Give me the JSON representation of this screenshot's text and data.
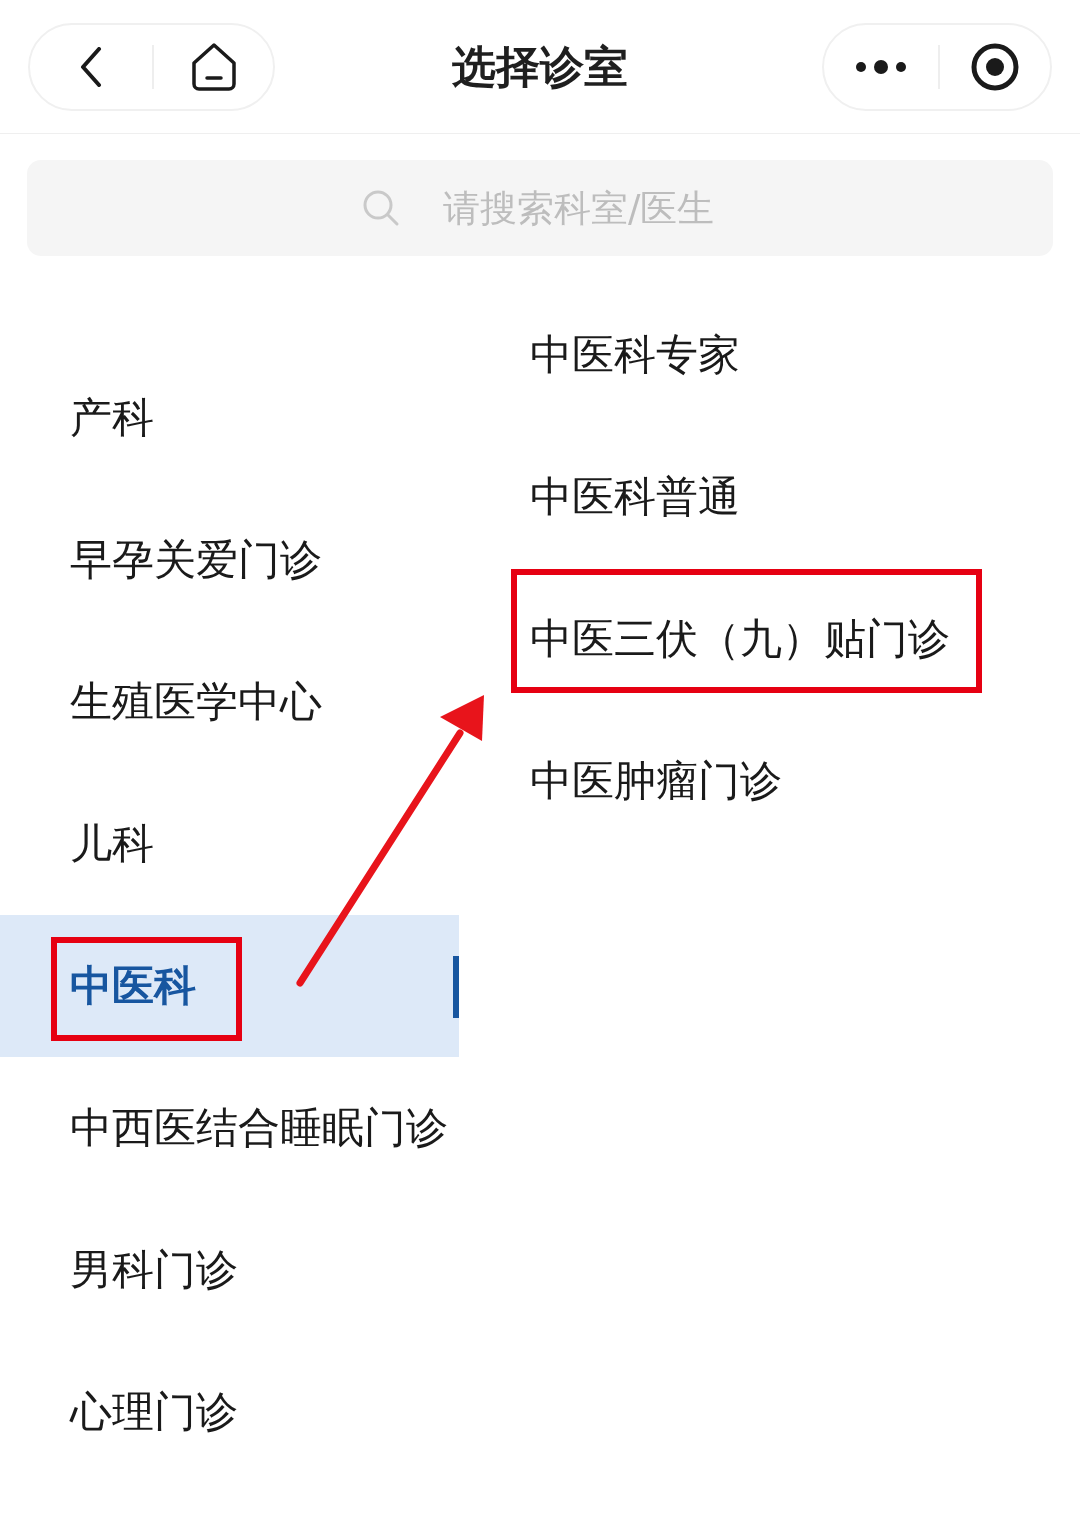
{
  "nav_bar": {
    "title": "选择诊室"
  },
  "search": {
    "placeholder": "请搜索科室/医生"
  },
  "departments": [
    {
      "label": "产科",
      "selected": false,
      "highlighted": false
    },
    {
      "label": "早孕关爱门诊",
      "selected": false,
      "highlighted": false
    },
    {
      "label": "生殖医学中心",
      "selected": false,
      "highlighted": false
    },
    {
      "label": "儿科",
      "selected": false,
      "highlighted": false
    },
    {
      "label": "中医科",
      "selected": true,
      "highlighted": true
    },
    {
      "label": "中西医结合睡眠门诊",
      "selected": false,
      "highlighted": false
    },
    {
      "label": "男科门诊",
      "selected": false,
      "highlighted": false
    },
    {
      "label": "心理门诊",
      "selected": false,
      "highlighted": false
    }
  ],
  "clinics": [
    {
      "label": "中医科专家",
      "highlighted": false
    },
    {
      "label": "中医科普通",
      "highlighted": false
    },
    {
      "label": "中医三伏（九）贴门诊",
      "highlighted": true
    },
    {
      "label": "中医肿瘤门诊",
      "highlighted": false
    }
  ]
}
